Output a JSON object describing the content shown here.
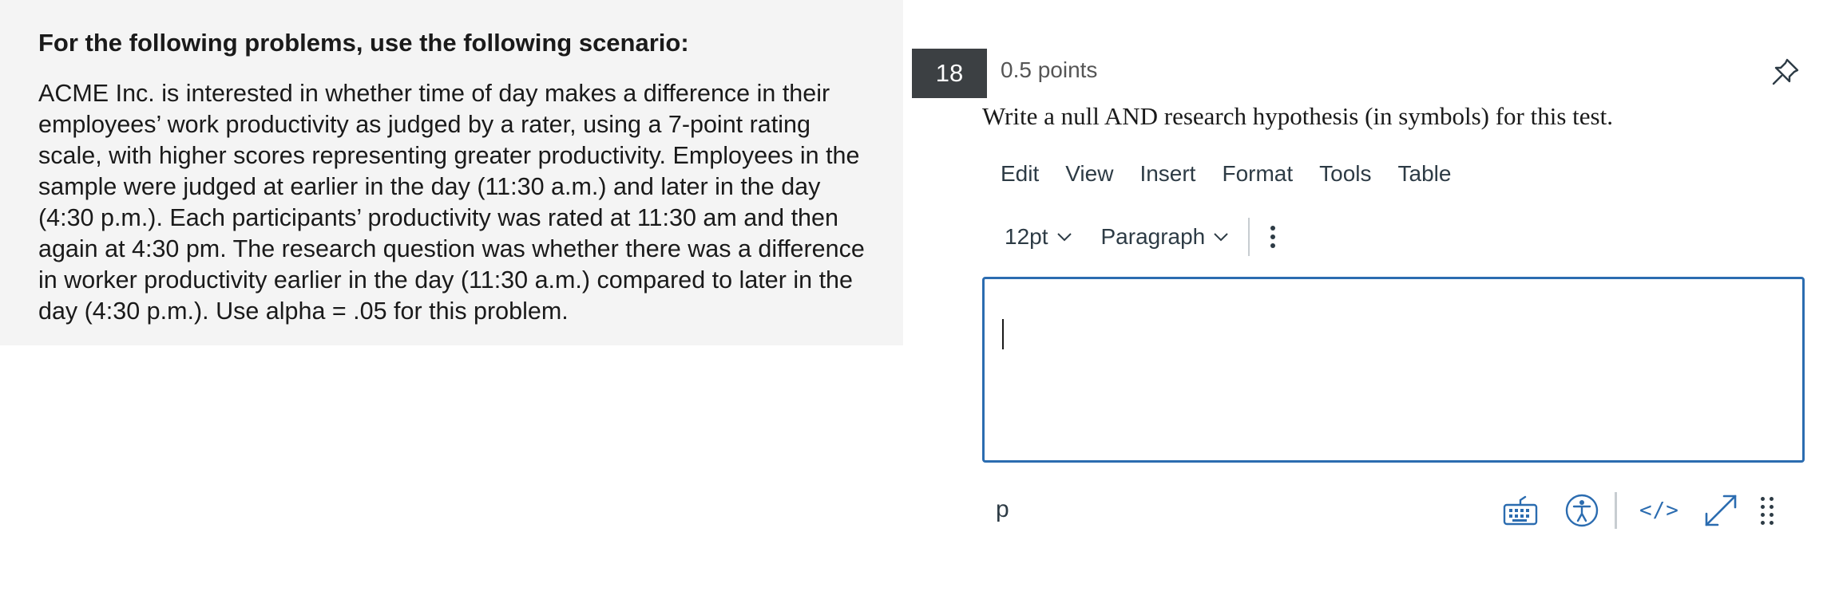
{
  "scenario": {
    "heading": "For the following problems, use the following scenario:",
    "body": "ACME Inc. is interested in whether time of day makes a difference in their employees’ work productivity as judged by a rater, using a 7-point rating scale, with higher scores representing greater productivity.  Employees in the sample were judged at earlier in the day (11:30 a.m.) and later in the day (4:30 p.m.).  Each participants’ productivity was rated at 11:30 am and then again at 4:30 pm.  The research question was whether there was a difference in worker productivity earlier in the day (11:30 a.m.) compared to later in the day (4:30 p.m.). Use alpha = .05 for this problem."
  },
  "question": {
    "number": "18",
    "points": "0.5 points",
    "text": "Write a null AND research hypothesis (in symbols) for this test."
  },
  "editor": {
    "menu": [
      "Edit",
      "View",
      "Insert",
      "Format",
      "Tools",
      "Table"
    ],
    "font_size": "12pt",
    "block_format": "Paragraph",
    "content": "",
    "status_path": "p"
  },
  "icons": {
    "pin": "pin-icon",
    "more": "kebab-icon",
    "keyboard": "keyboard-icon",
    "accessibility": "accessibility-icon",
    "html": "html-code-icon",
    "fullscreen": "fullscreen-icon",
    "resize": "resize-grip-icon"
  },
  "colors": {
    "accent": "#2b6cb0",
    "question_badge": "#3c4043",
    "panel_bg": "#f4f4f4"
  }
}
